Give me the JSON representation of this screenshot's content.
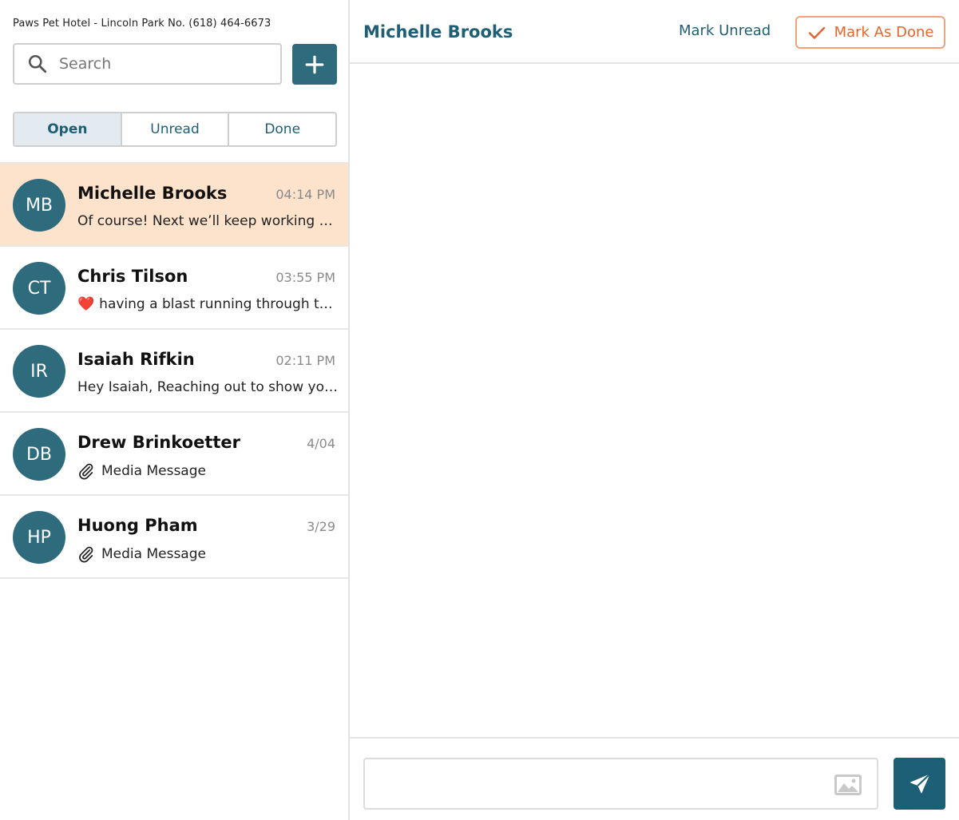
{
  "sidebar": {
    "business_line": "Paws Pet Hotel - Lincoln Park No. (618) 464-6673",
    "search": {
      "placeholder": "Search",
      "value": ""
    },
    "add_button_icon": "plus-icon",
    "tabs": [
      {
        "label": "Open",
        "active": true
      },
      {
        "label": "Unread",
        "active": false
      },
      {
        "label": "Done",
        "active": false
      }
    ],
    "conversations": [
      {
        "initials": "MB",
        "name": "Michelle Brooks",
        "time": "04:14 PM",
        "preview": "Of course! Next we’ll keep working on making sure they are having fun",
        "selected": true
      },
      {
        "initials": "CT",
        "name": "Chris Tilson",
        "time": "03:55 PM",
        "preview": "having a blast running through the field",
        "emoji": "❤️"
      },
      {
        "initials": "IR",
        "name": "Isaiah Rifkin",
        "time": "02:11 PM",
        "preview": "Hey Isaiah, Reaching out to show you how your pet is doing"
      },
      {
        "initials": "DB",
        "name": "Drew Brinkoetter",
        "time": "4/04",
        "preview": "Media Message",
        "attachment": true
      },
      {
        "initials": "HP",
        "name": "Huong Pham",
        "time": "3/29",
        "preview": "Media Message",
        "attachment": true
      }
    ]
  },
  "conversation": {
    "contact_name": "Michelle Brooks",
    "mark_unread_label": "Mark Unread",
    "mark_done_label": "Mark As Done",
    "message_input": {
      "placeholder": "",
      "value": ""
    }
  },
  "colors": {
    "primary": "#2e6b7d",
    "accent_orange": "#e8642c",
    "selected_bg": "#fde2cc",
    "heart": "#e0202f"
  }
}
